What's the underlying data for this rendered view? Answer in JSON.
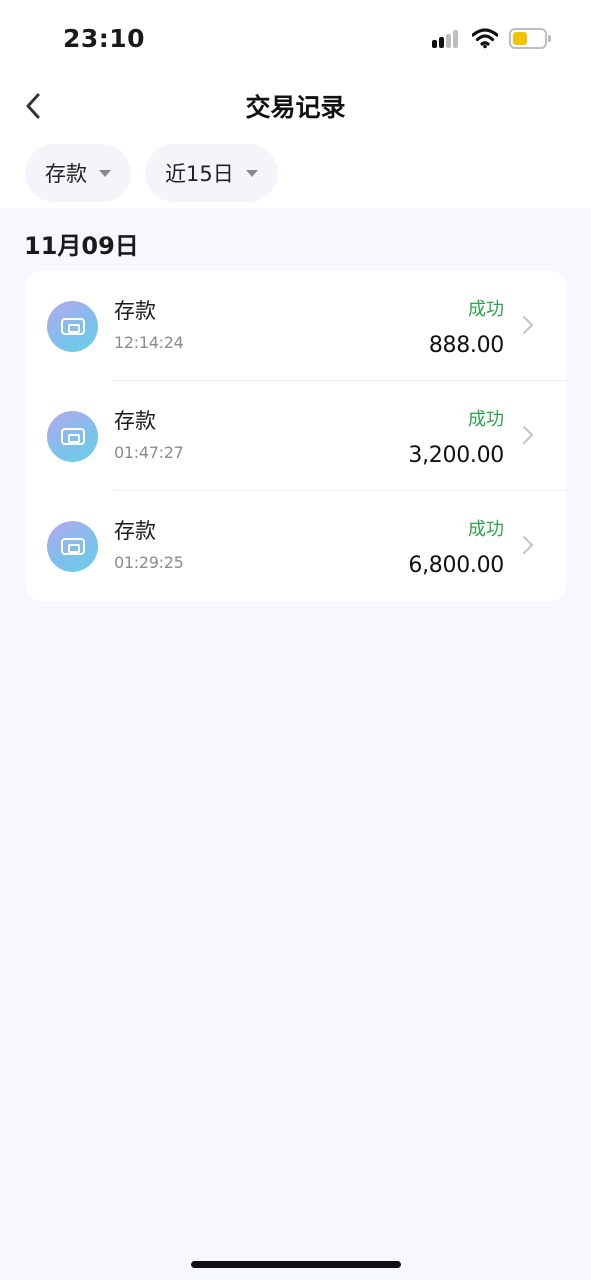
{
  "status_bar": {
    "time": "23:10",
    "battery_color": "#f5c400"
  },
  "header": {
    "title": "交易记录",
    "back_icon": "chevron-left-icon"
  },
  "filters": [
    {
      "label": "存款",
      "icon": "caret-down-icon"
    },
    {
      "label": "近15日",
      "icon": "caret-down-icon"
    }
  ],
  "date_group": "11月09日",
  "transactions": [
    {
      "title": "存款",
      "time": "12:14:24",
      "status": "成功",
      "amount": "888.00",
      "icon": "wallet-icon"
    },
    {
      "title": "存款",
      "time": "01:47:27",
      "status": "成功",
      "amount": "3,200.00",
      "icon": "wallet-icon"
    },
    {
      "title": "存款",
      "time": "01:29:25",
      "status": "成功",
      "amount": "6,800.00",
      "icon": "wallet-icon"
    }
  ],
  "colors": {
    "status_success": "#2fa34f",
    "page_background": "#f7f8fd",
    "card_background": "#ffffff"
  }
}
